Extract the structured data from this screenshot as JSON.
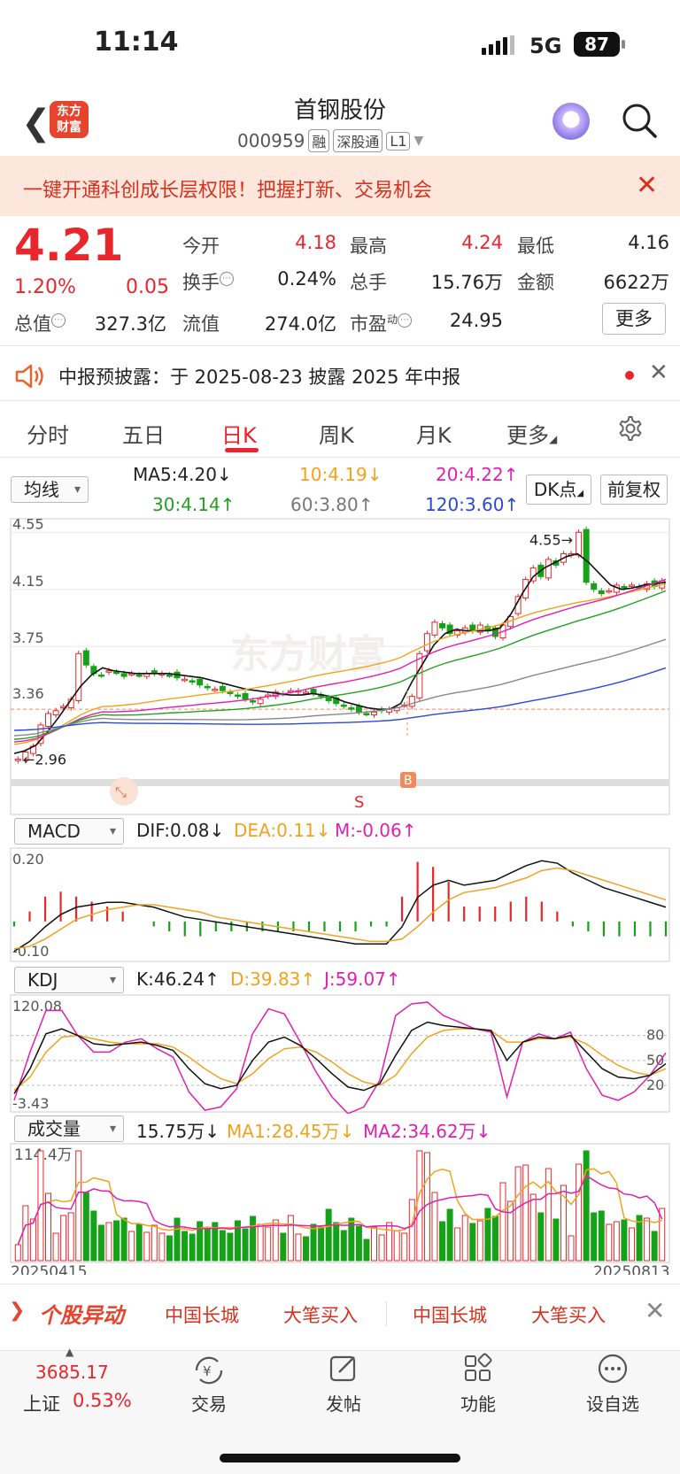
{
  "status": {
    "time": "11:14",
    "network": "5G",
    "battery": "87"
  },
  "header": {
    "logo_line1": "东方",
    "logo_line2": "财富",
    "stock_name": "首钢股份",
    "stock_code": "000959",
    "tags": [
      "融",
      "深股通",
      "L1"
    ]
  },
  "banner": {
    "text": "一键开通科创成长层权限！把握打新、交易机会"
  },
  "quote": {
    "price": "4.21",
    "change_pct": "1.20%",
    "change": "0.05",
    "open_label": "今开",
    "open": "4.18",
    "high_label": "最高",
    "high": "4.24",
    "low_label": "最低",
    "low": "4.16",
    "turnover_label": "换手",
    "turnover": "0.24%",
    "volume_label": "总手",
    "volume": "15.76万",
    "amount_label": "金额",
    "amount": "6622万",
    "mktcap_label": "总值",
    "mktcap": "327.3亿",
    "float_label": "流值",
    "float_cap": "274.0亿",
    "pe_label": "市盈",
    "pe_sup": "动",
    "pe": "24.95",
    "more_label": "更多"
  },
  "announcement": {
    "text": "中报预披露：于 2025-08-23 披露 2025 年中报"
  },
  "tabs": [
    "分时",
    "五日",
    "日K",
    "周K",
    "月K",
    "更多"
  ],
  "indicators": {
    "ma_select": "均线",
    "ma5": "MA5:4.20↓",
    "ma10": "10:4.19↓",
    "ma20": "20:4.22↑",
    "ma30": "30:4.14↑",
    "ma60": "60:3.80↑",
    "ma120": "120:3.60↑",
    "dk_label": "DK点",
    "adj_label": "前复权",
    "macd_select": "MACD",
    "dif": "DIF:0.08↓",
    "dea": "DEA:0.11↓",
    "m": "M:-0.06↑",
    "kdj_select": "KDJ",
    "k": "K:46.24↑",
    "d": "D:39.83↑",
    "j": "J:59.07↑",
    "vol_select": "成交量",
    "vol": "15.75万↓",
    "vol_ma1": "MA1:28.45万↓",
    "vol_ma2": "MA2:34.62万↓"
  },
  "chart_data": [
    {
      "type": "candlestick",
      "title": "日K",
      "y_ticks": [
        "4.55",
        "4.15",
        "3.75",
        "3.36",
        "2.96"
      ],
      "ylim": [
        2.92,
        4.62
      ],
      "annotations": {
        "high_marker": "4.55→",
        "low_marker": "←2.96",
        "buy_marker": "B",
        "sell_marker": "S",
        "watermark": "东方财富"
      },
      "close": [
        2.96,
        3.01,
        3.05,
        3.2,
        3.28,
        3.3,
        3.33,
        3.38,
        3.7,
        3.62,
        3.56,
        3.55,
        3.58,
        3.57,
        3.54,
        3.56,
        3.55,
        3.56,
        3.56,
        3.56,
        3.55,
        3.53,
        3.52,
        3.5,
        3.48,
        3.46,
        3.45,
        3.44,
        3.42,
        3.4,
        3.38,
        3.36,
        3.38,
        3.41,
        3.43,
        3.42,
        3.44,
        3.44,
        3.43,
        3.42,
        3.4,
        3.37,
        3.35,
        3.33,
        3.31,
        3.29,
        3.28,
        3.29,
        3.3,
        3.31,
        3.32,
        3.34,
        3.4,
        3.7,
        3.84,
        3.92,
        3.88,
        3.84,
        3.86,
        3.88,
        3.86,
        3.9,
        3.86,
        3.82,
        3.9,
        3.96,
        4.1,
        4.22,
        4.3,
        4.24,
        4.36,
        4.32,
        4.4,
        4.4,
        4.55,
        4.2,
        4.15,
        4.12,
        4.14,
        4.18,
        4.16,
        4.18,
        4.16,
        4.19,
        4.17,
        4.21
      ],
      "ma5": [
        3.0,
        3.02,
        3.06,
        3.15,
        3.25,
        3.36,
        3.47,
        3.55,
        3.6,
        3.58,
        3.57,
        3.56,
        3.56,
        3.56,
        3.56,
        3.55,
        3.54,
        3.53,
        3.51,
        3.49,
        3.47,
        3.45,
        3.44,
        3.43,
        3.42,
        3.41,
        3.41,
        3.42,
        3.41,
        3.39,
        3.36,
        3.34,
        3.32,
        3.31,
        3.31,
        3.35,
        3.5,
        3.63,
        3.76,
        3.84,
        3.87,
        3.86,
        3.86,
        3.86,
        3.88,
        3.98,
        4.12,
        4.24,
        4.3,
        4.34,
        4.38,
        4.4,
        4.34,
        4.26,
        4.18,
        4.15,
        4.16,
        4.18,
        4.19,
        4.2
      ],
      "ma10": "4.19",
      "ma20": "4.22",
      "ma30": "4.14",
      "ma60": "3.80",
      "ma120": "3.60"
    },
    {
      "type": "bar+line",
      "name": "MACD",
      "y_ticks": [
        "0.20",
        "-0.10"
      ],
      "dif": [
        -0.1,
        -0.06,
        0.0,
        0.05,
        0.08,
        0.09,
        0.1,
        0.1,
        0.09,
        0.08,
        0.06,
        0.04,
        0.03,
        0.02,
        0.01,
        0.0,
        -0.01,
        -0.02,
        -0.03,
        -0.04,
        -0.05,
        -0.06,
        -0.07,
        -0.07,
        -0.07,
        0.0,
        0.12,
        0.17,
        0.19,
        0.17,
        0.18,
        0.19,
        0.22,
        0.25,
        0.27,
        0.26,
        0.22,
        0.19,
        0.16,
        0.14,
        0.12,
        0.1,
        0.08
      ],
      "dea": [
        -0.09,
        -0.08,
        -0.05,
        -0.01,
        0.03,
        0.05,
        0.07,
        0.08,
        0.09,
        0.09,
        0.08,
        0.07,
        0.06,
        0.04,
        0.03,
        0.02,
        0.01,
        0.0,
        -0.01,
        -0.02,
        -0.03,
        -0.04,
        -0.05,
        -0.06,
        -0.06,
        -0.05,
        0.0,
        0.06,
        0.11,
        0.14,
        0.15,
        0.16,
        0.18,
        0.2,
        0.23,
        0.24,
        0.23,
        0.21,
        0.19,
        0.17,
        0.15,
        0.13,
        0.11
      ]
    },
    {
      "type": "line",
      "name": "KDJ",
      "y_ticks": [
        "120.08",
        "80",
        "50",
        "20",
        "-3.43"
      ],
      "k": [
        10,
        40,
        82,
        88,
        80,
        70,
        68,
        70,
        72,
        68,
        62,
        40,
        22,
        16,
        20,
        50,
        72,
        78,
        68,
        52,
        34,
        18,
        14,
        22,
        56,
        86,
        96,
        92,
        90,
        88,
        86,
        50,
        72,
        78,
        76,
        80,
        60,
        40,
        30,
        28,
        32,
        46
      ],
      "d": [
        14,
        30,
        60,
        78,
        80,
        76,
        72,
        70,
        70,
        70,
        66,
        54,
        40,
        28,
        22,
        34,
        52,
        64,
        66,
        60,
        48,
        34,
        24,
        20,
        32,
        58,
        78,
        86,
        88,
        88,
        86,
        72,
        72,
        76,
        76,
        78,
        70,
        56,
        44,
        36,
        32,
        40
      ],
      "j": [
        2,
        60,
        110,
        110,
        80,
        60,
        60,
        72,
        76,
        64,
        54,
        12,
        -10,
        -6,
        16,
        82,
        112,
        106,
        72,
        36,
        6,
        -14,
        -6,
        26,
        104,
        118,
        120,
        104,
        96,
        88,
        84,
        6,
        72,
        82,
        76,
        84,
        40,
        8,
        2,
        12,
        32,
        59
      ]
    },
    {
      "type": "bar+line",
      "name": "成交量",
      "y_ticks": [
        "114.4万"
      ],
      "x_ticks": [
        "20250415",
        "20250813"
      ],
      "ma1": "28.45万",
      "ma2": "34.62万"
    }
  ],
  "marquee": {
    "title": "个股异动",
    "items": [
      "中国长城",
      "大笔买入",
      "中国长城",
      "大笔买入"
    ]
  },
  "bottom_bar": {
    "index_value": "3685.17",
    "index_name": "上证",
    "index_pct": "0.53%",
    "items": [
      "交易",
      "发帖",
      "功能",
      "设自选"
    ]
  }
}
